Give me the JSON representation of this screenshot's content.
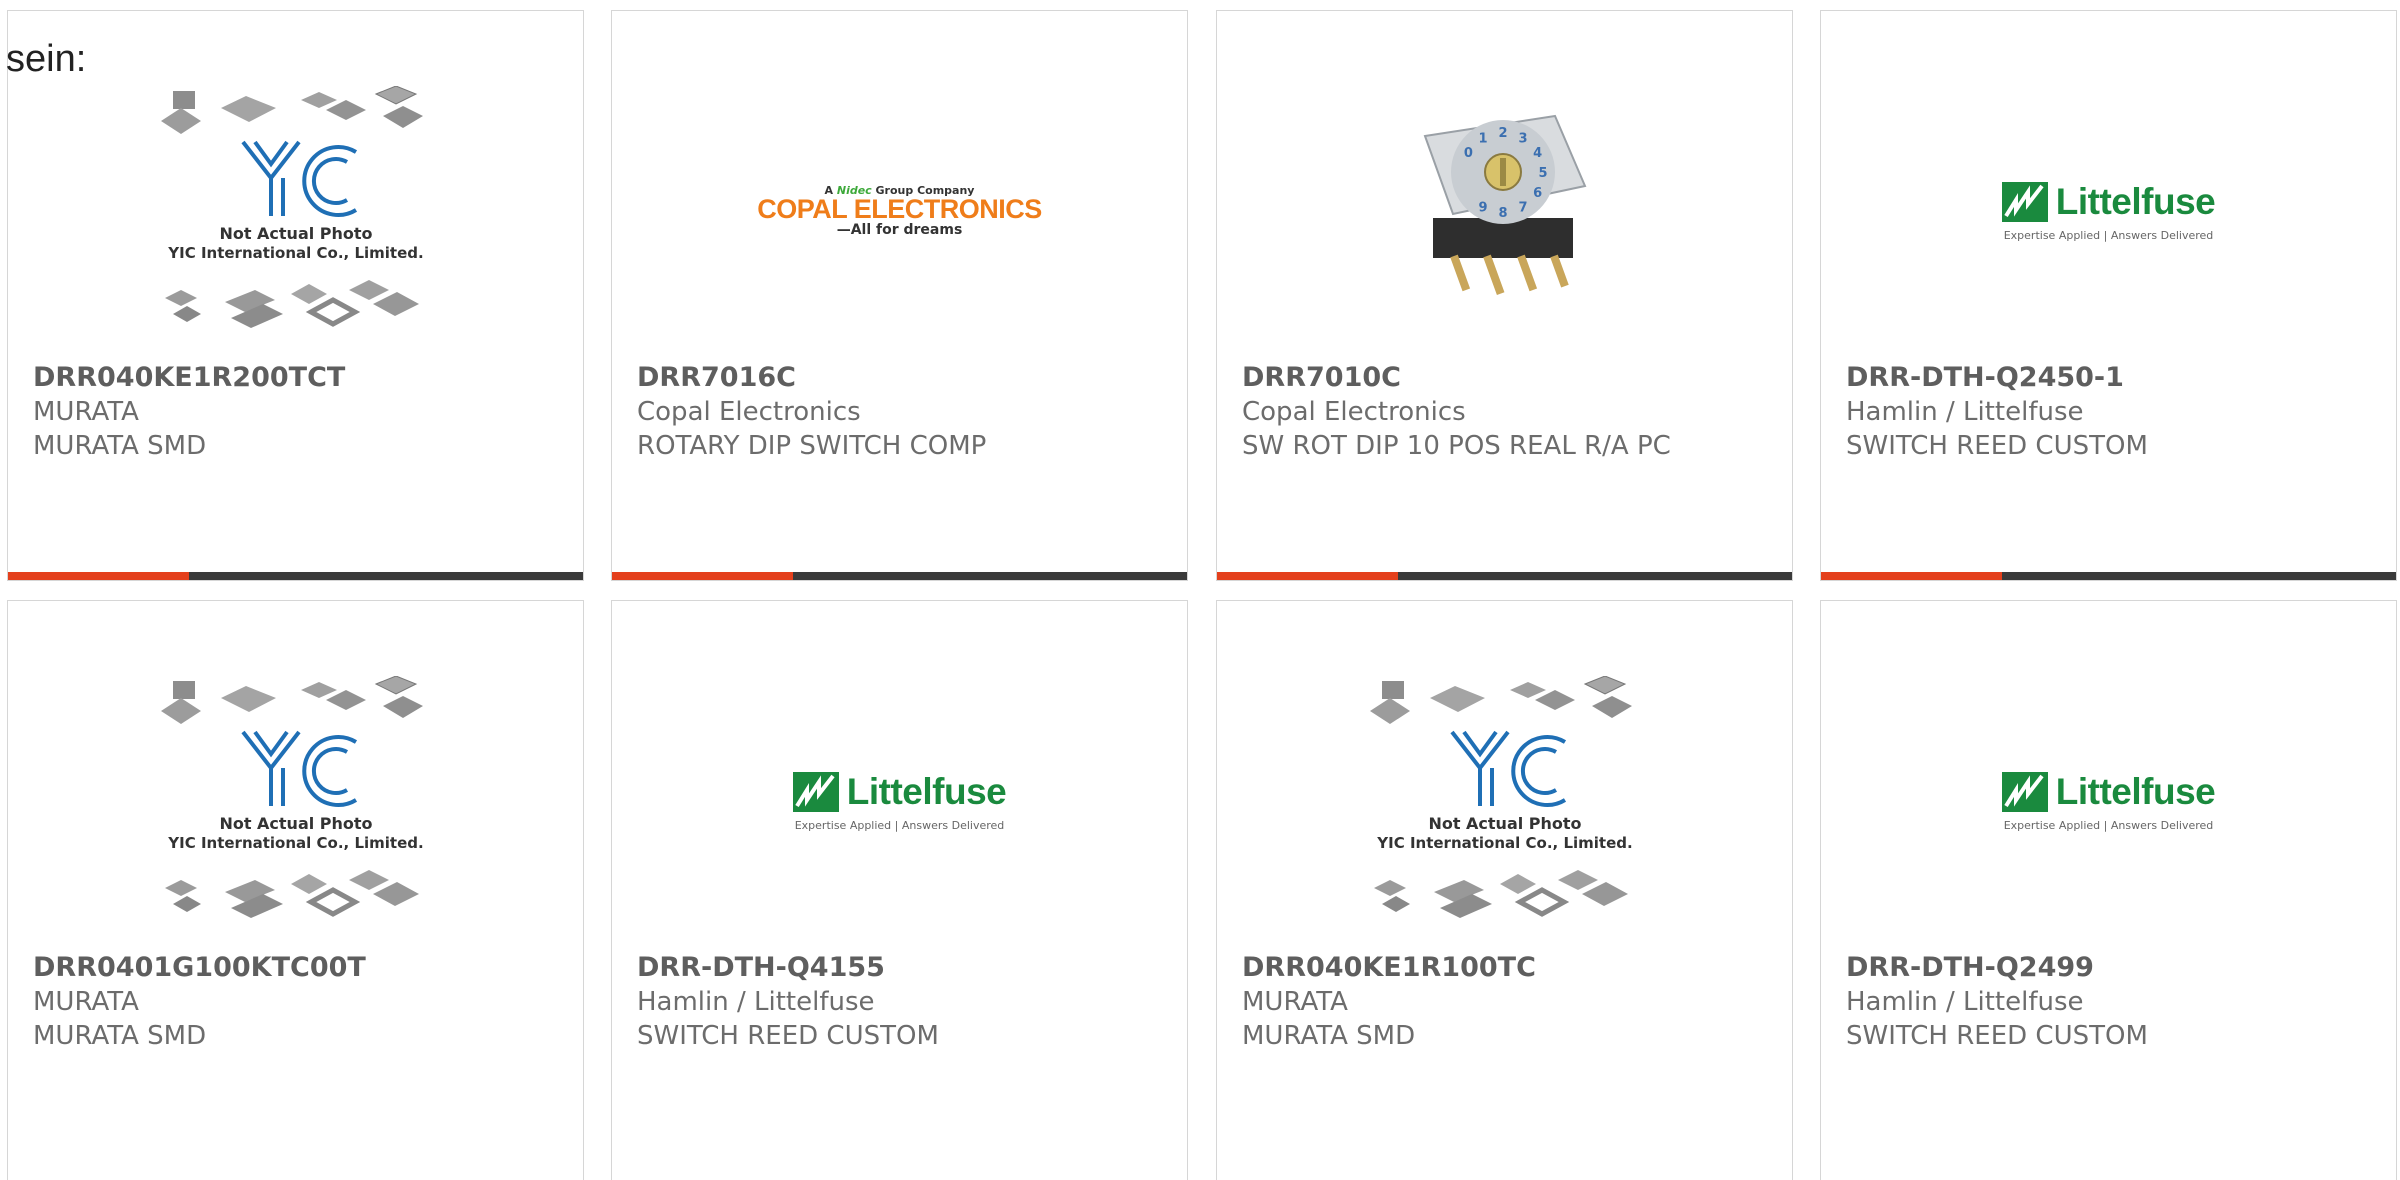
{
  "page": {
    "label": "sein:"
  },
  "colors": {
    "accent": "#e4401c",
    "bar": "#3a3a3a",
    "littelfuse_green": "#1a8a3e",
    "copal_orange": "#ef7d1a",
    "yic_blue": "#1f6fb5"
  },
  "placeholder": {
    "line1": "Not Actual Photo",
    "line2": "YIC International Co., Limited.",
    "logo_text": "YIC"
  },
  "logos": {
    "copal": {
      "small_prefix": "A",
      "small_brand": "Nidec",
      "small_suffix": "Group Company",
      "name": "COPAL ELECTRONICS",
      "tagline": "—All for dreams"
    },
    "littelfuse": {
      "name": "Littelfuse",
      "tagline": "Expertise Applied | Answers Delivered"
    }
  },
  "products": [
    {
      "part_number": "DRR040KE1R200TCT",
      "manufacturer": "MURATA",
      "description": "MURATA SMD",
      "image": "placeholder"
    },
    {
      "part_number": "DRR7016C",
      "manufacturer": "Copal Electronics",
      "description": "ROTARY DIP SWITCH COMP",
      "image": "copal-logo"
    },
    {
      "part_number": "DRR7010C",
      "manufacturer": "Copal Electronics",
      "description": "SW ROT DIP 10 POS REAL R/A PC",
      "image": "rotary-switch-photo",
      "dial_digits": "0123456789"
    },
    {
      "part_number": "DRR-DTH-Q2450-1",
      "manufacturer": "Hamlin / Littelfuse",
      "description": "SWITCH REED CUSTOM",
      "image": "littelfuse-logo"
    },
    {
      "part_number": "DRR0401G100KTC00T",
      "manufacturer": "MURATA",
      "description": "MURATA SMD",
      "image": "placeholder"
    },
    {
      "part_number": "DRR-DTH-Q4155",
      "manufacturer": "Hamlin / Littelfuse",
      "description": "SWITCH REED CUSTOM",
      "image": "littelfuse-logo"
    },
    {
      "part_number": "DRR040KE1R100TC",
      "manufacturer": "MURATA",
      "description": "MURATA SMD",
      "image": "placeholder"
    },
    {
      "part_number": "DRR-DTH-Q2499",
      "manufacturer": "Hamlin / Littelfuse",
      "description": "SWITCH REED CUSTOM",
      "image": "littelfuse-logo"
    }
  ]
}
